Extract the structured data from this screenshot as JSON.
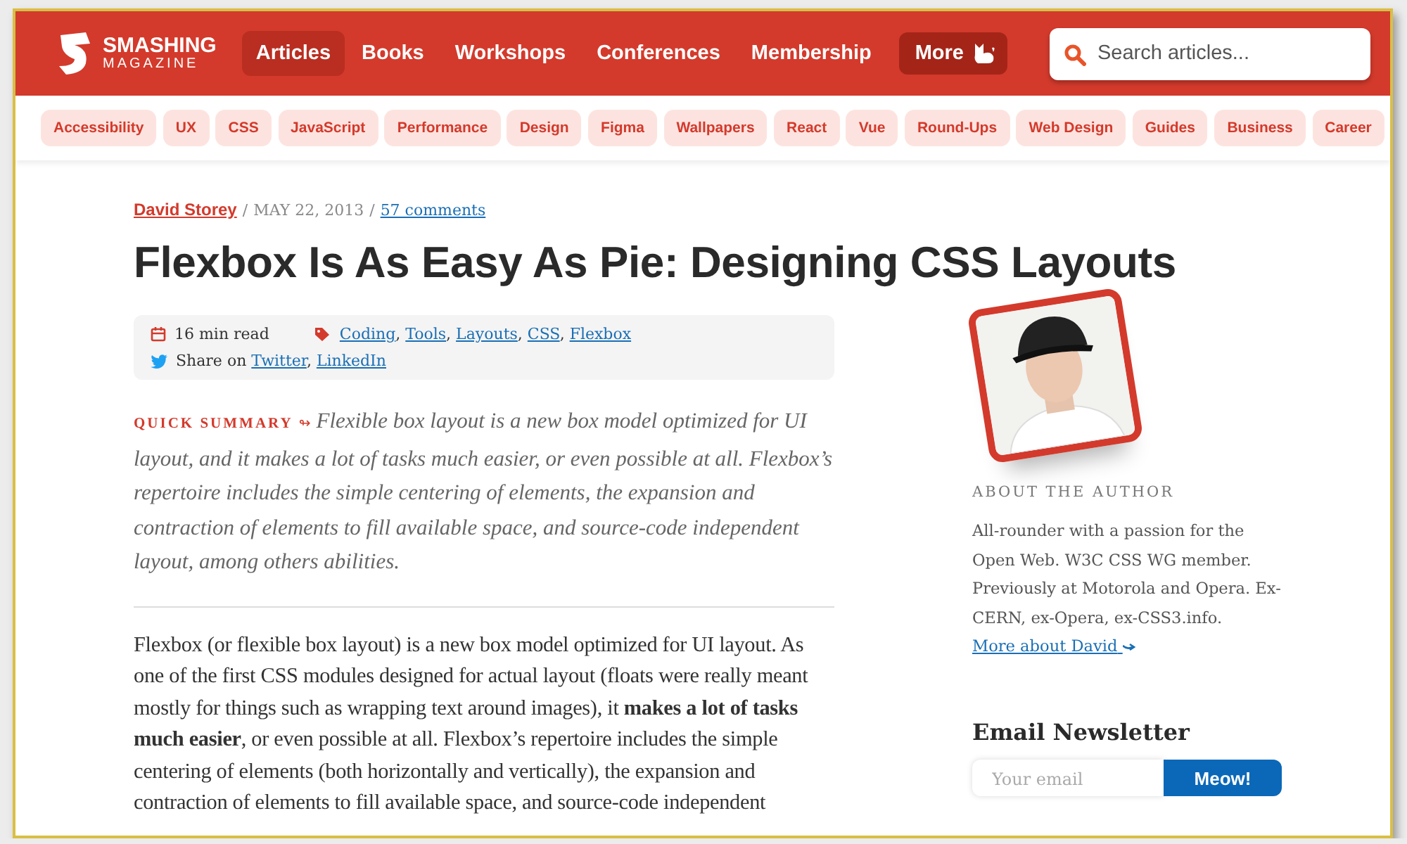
{
  "header": {
    "logo": {
      "title": "SMASHING",
      "subtitle": "MAGAZINE"
    },
    "nav": [
      {
        "label": "Articles",
        "selected": true
      },
      {
        "label": "Books",
        "selected": false
      },
      {
        "label": "Workshops",
        "selected": false
      },
      {
        "label": "Conferences",
        "selected": false
      },
      {
        "label": "Membership",
        "selected": false
      }
    ],
    "more": {
      "label": "More"
    },
    "search": {
      "placeholder": "Search articles..."
    }
  },
  "tags": [
    "Accessibility",
    "UX",
    "CSS",
    "JavaScript",
    "Performance",
    "Design",
    "Figma",
    "Wallpapers",
    "React",
    "Vue",
    "Round-Ups",
    "Web Design",
    "Guides",
    "Business",
    "Career"
  ],
  "article": {
    "byline": {
      "author": "David Storey",
      "separator": "/",
      "date": "MAY 22, 2013",
      "comments": "57 comments"
    },
    "title": "Flexbox Is As Easy As Pie: Designing CSS Layouts",
    "meta": {
      "read_time": "16 min read",
      "categories": [
        "Coding",
        "Tools",
        "Layouts",
        "CSS",
        "Flexbox"
      ],
      "list_separator": ",",
      "share_label": "Share on",
      "share_links": [
        "Twitter",
        "LinkedIn"
      ]
    },
    "summary": {
      "label": "QUICK SUMMARY",
      "marker": "↬",
      "text": "Flexible box layout is a new box model optimized for UI layout, and it makes a lot of tasks much easier, or even possible at all. Flexbox’s repertoire includes the simple centering of elements, the expansion and contraction of elements to fill available space, and source-code independent layout, among others abilities."
    },
    "body": "Flexbox (or flexible box layout) is a new box model optimized for UI layout. As one of the first CSS modules designed for actual layout (floats were really meant mostly for things such as wrapping text around images), it **makes a lot of tasks much easier**, or even possible at all. Flexbox’s repertoire includes the simple centering of elements (both horizontally and vertically), the expansion and contraction of elements to fill available space, and source-code independent"
  },
  "sidebar": {
    "about_label": "ABOUT THE AUTHOR",
    "bio": "All-rounder with a passion for the Open Web. W3C CSS WG member. Previously at Motorola and Opera. Ex-CERN, ex-Opera, ex-CSS3.info.",
    "bio_link": "More about David",
    "newsletter": {
      "title": "Email Newsletter",
      "placeholder": "Your email",
      "button": "Meow!"
    }
  }
}
